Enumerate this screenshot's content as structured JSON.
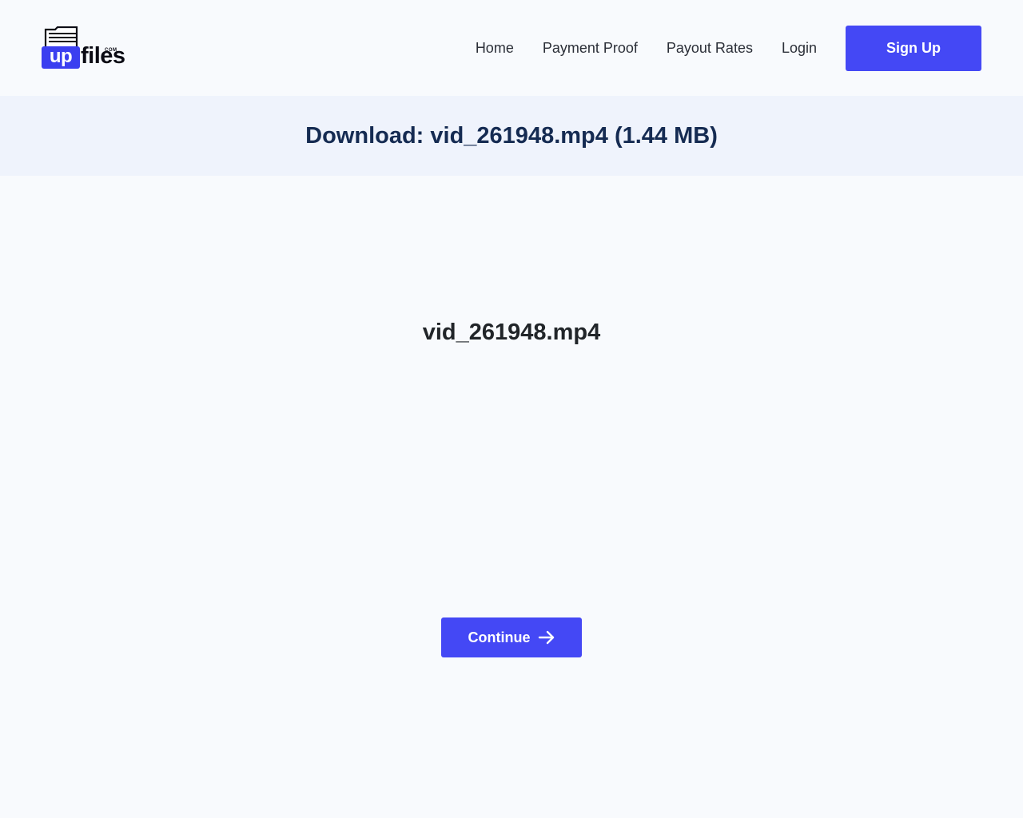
{
  "header": {
    "logo": {
      "up_text": "up",
      "files_text": "files",
      "com_text": "COM"
    },
    "nav": [
      {
        "label": "Home"
      },
      {
        "label": "Payment Proof"
      },
      {
        "label": "Payout Rates"
      },
      {
        "label": "Login"
      }
    ],
    "signup_label": "Sign Up"
  },
  "banner": {
    "title": "Download: vid_261948.mp4 (1.44 MB)"
  },
  "main": {
    "file_name": "vid_261948.mp4",
    "continue_label": "Continue",
    "continue_icon": "arrow-right-icon"
  },
  "colors": {
    "accent": "#4448f5",
    "banner_bg": "#eff3fc",
    "title": "#152b52"
  }
}
